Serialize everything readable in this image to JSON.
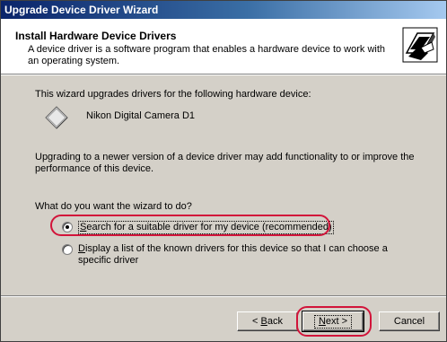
{
  "window": {
    "title": "Upgrade Device Driver Wizard"
  },
  "header": {
    "title": "Install Hardware Device Drivers",
    "subtitle": "A device driver is a software program that enables a hardware device to work with an operating system.",
    "icon": "hardware-wizard-icon"
  },
  "content": {
    "intro": "This wizard upgrades drivers for the following hardware device:",
    "device_name": "Nikon Digital Camera D1",
    "device_icon": "device-diamond-icon",
    "upgrade_note": "Upgrading to a newer version of a device driver may add functionality to or improve the performance of this device.",
    "question": "What do you want the wizard to do?",
    "options": [
      {
        "prefix": "S",
        "label": "earch for a suitable driver for my device (recommended)",
        "selected": true
      },
      {
        "prefix": "D",
        "label": "isplay a list of the known drivers for this device so that I can choose a specific driver",
        "selected": false
      }
    ]
  },
  "buttons": {
    "back_prefix": "< ",
    "back_accel": "B",
    "back_rest": "ack",
    "next_accel": "N",
    "next_rest": "ext >",
    "cancel": "Cancel"
  },
  "colors": {
    "highlight": "#d2143a",
    "title_bar": "#0a246a",
    "dialog_bg": "#d4d0c8"
  }
}
